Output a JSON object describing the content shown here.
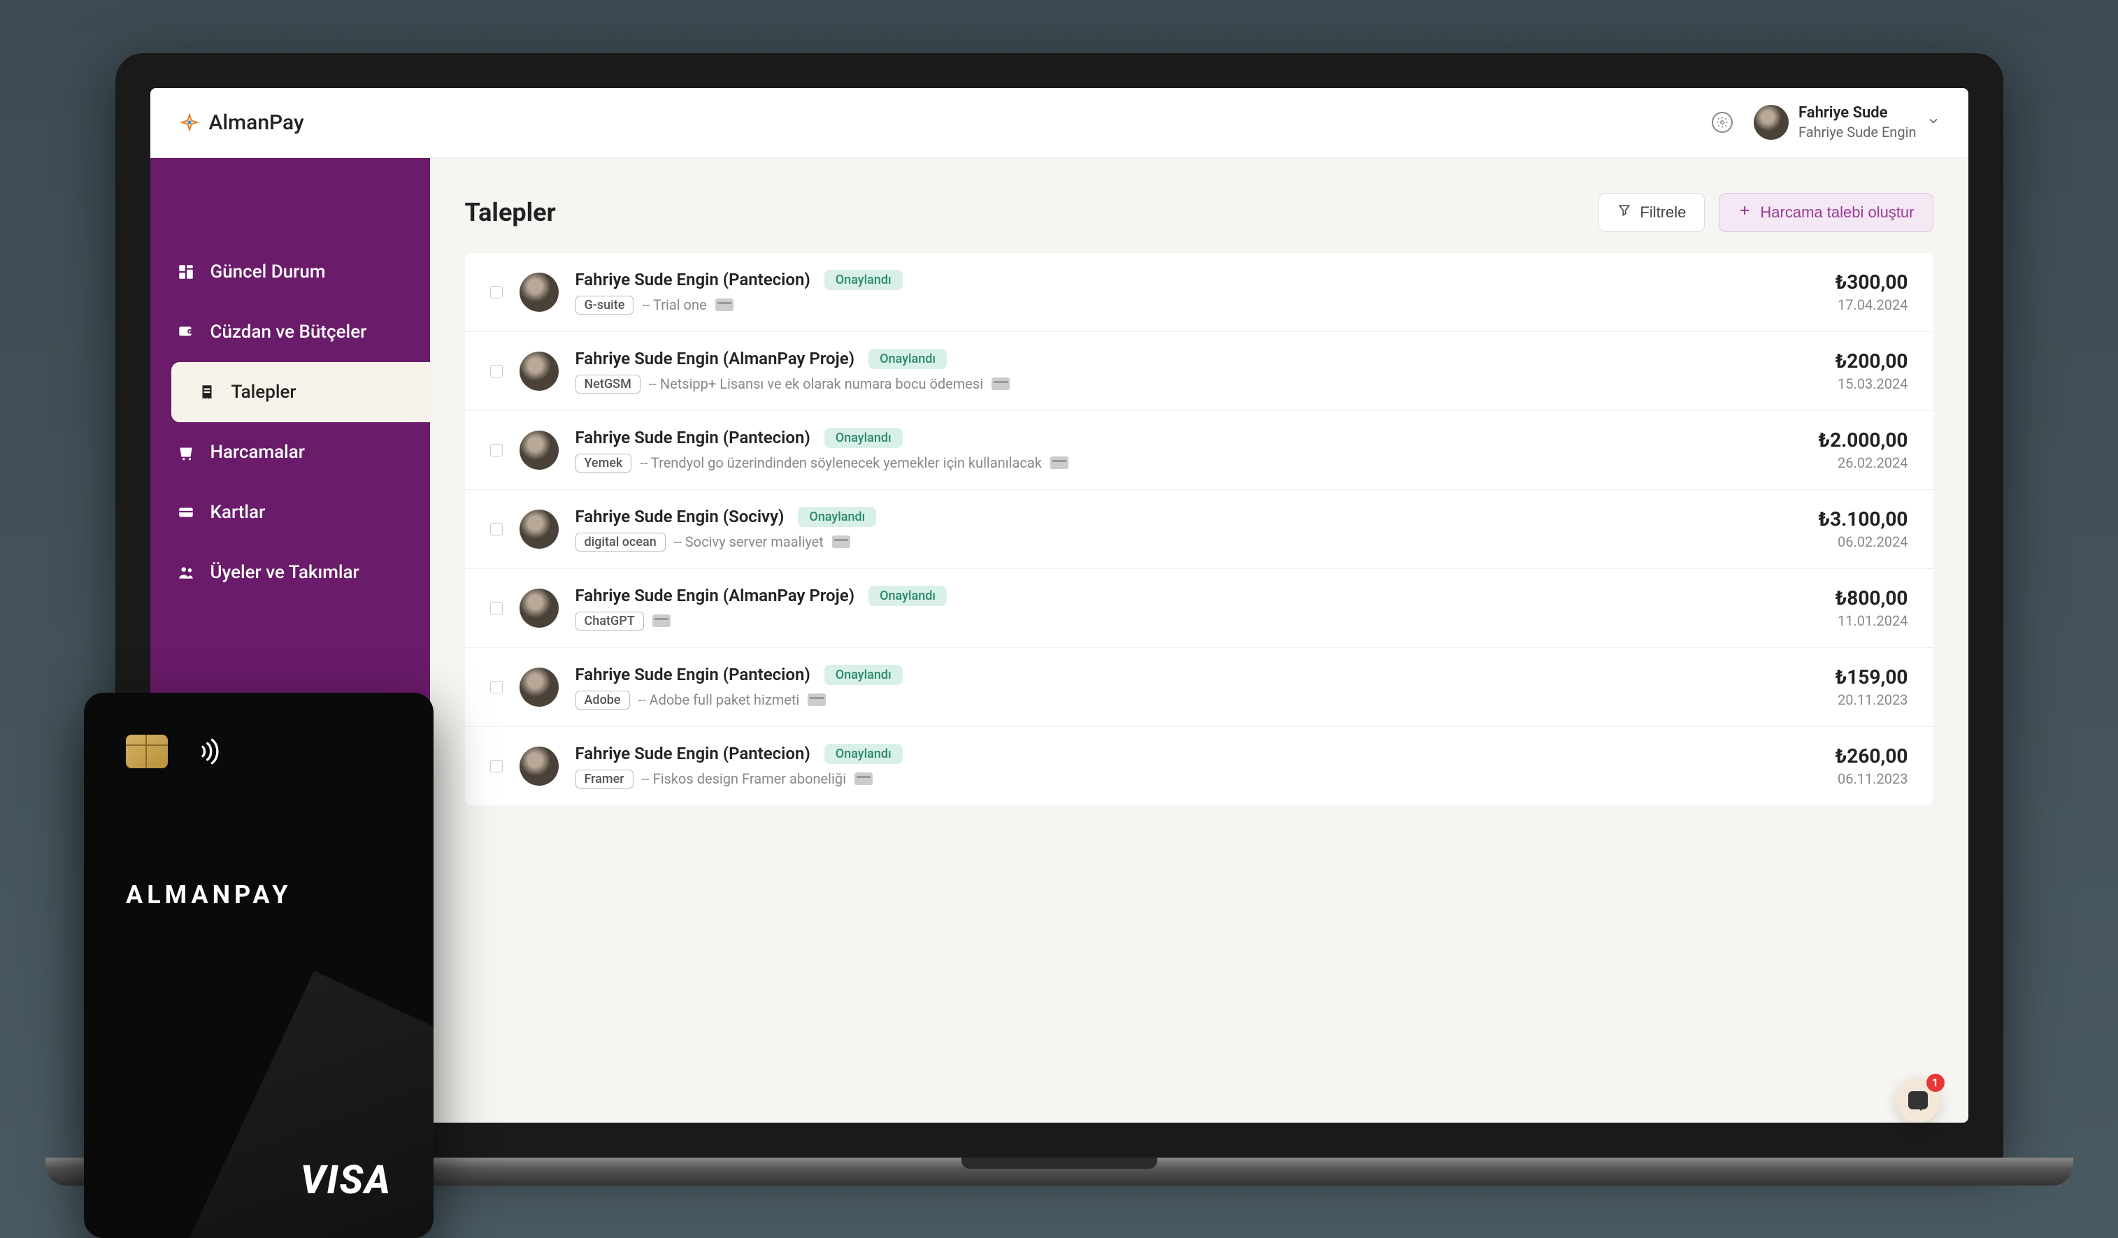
{
  "brand": {
    "name": "AlmanPay"
  },
  "user": {
    "name": "Fahriye Sude",
    "subtitle": "Fahriye Sude Engin"
  },
  "sidebar": {
    "items": [
      {
        "label": "Güncel Durum",
        "icon": "dashboard"
      },
      {
        "label": "Cüzdan ve Bütçeler",
        "icon": "wallet"
      },
      {
        "label": "Talepler",
        "icon": "receipt",
        "active": true
      },
      {
        "label": "Harcamalar",
        "icon": "expenses"
      },
      {
        "label": "Kartlar",
        "icon": "card"
      },
      {
        "label": "Üyeler ve Takımlar",
        "icon": "team"
      }
    ]
  },
  "page": {
    "title": "Talepler"
  },
  "actions": {
    "filter": "Filtrele",
    "create": "Harcama talebi oluştur"
  },
  "status_labels": {
    "approved": "Onaylandı"
  },
  "requests": [
    {
      "title": "Fahriye Sude Engin (Pantecion)",
      "status": "approved",
      "tag": "G-suite",
      "note": "Trial one",
      "amount": "₺300,00",
      "date": "17.04.2024"
    },
    {
      "title": "Fahriye Sude Engin (AlmanPay Proje)",
      "status": "approved",
      "tag": "NetGSM",
      "note": "Netsipp+ Lisansı ve ek olarak numara bocu ödemesi",
      "amount": "₺200,00",
      "date": "15.03.2024"
    },
    {
      "title": "Fahriye Sude Engin (Pantecion)",
      "status": "approved",
      "tag": "Yemek",
      "note": "Trendyol go üzerindinden söylenecek yemekler için kullanılacak",
      "amount": "₺2.000,00",
      "date": "26.02.2024"
    },
    {
      "title": "Fahriye Sude Engin (Socivy)",
      "status": "approved",
      "tag": "digital ocean",
      "note": "Socivy server maaliyet",
      "amount": "₺3.100,00",
      "date": "06.02.2024"
    },
    {
      "title": "Fahriye Sude Engin (AlmanPay Proje)",
      "status": "approved",
      "tag": "ChatGPT",
      "note": "",
      "amount": "₺800,00",
      "date": "11.01.2024"
    },
    {
      "title": "Fahriye Sude Engin (Pantecion)",
      "status": "approved",
      "tag": "Adobe",
      "note": "Adobe full paket hizmeti",
      "amount": "₺159,00",
      "date": "20.11.2023"
    },
    {
      "title": "Fahriye Sude Engin (Pantecion)",
      "status": "approved",
      "tag": "Framer",
      "note": "Fiskos design Framer aboneliği",
      "amount": "₺260,00",
      "date": "06.11.2023"
    }
  ],
  "card": {
    "brand": "ALMANPAY",
    "network": "VISA"
  },
  "intercom": {
    "badge": "1"
  },
  "colors": {
    "sidebar": "#6a1b6a",
    "accent": "#9a3b9a",
    "approved_bg": "#d9f0e8",
    "approved_fg": "#2a8a6a"
  }
}
